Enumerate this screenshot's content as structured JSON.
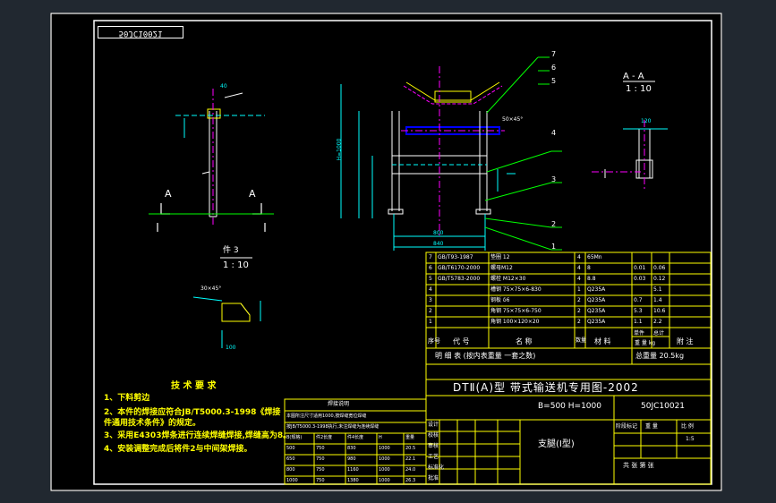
{
  "drawing": {
    "stamp": "50JC10021",
    "section_label": "A - A",
    "section_scale": "1 : 10",
    "detail_label": "件 3",
    "detail_scale": "1 : 10",
    "cut_a_left": "A",
    "cut_a_right": "A",
    "height_dim": "H=1000",
    "width_dim_1": "800",
    "width_dim_2": "840",
    "chamfer_1": "50×45°",
    "chamfer_2": "30×45°",
    "dim_120": "120",
    "dim_100": "100",
    "dim_40": "40",
    "callouts": [
      "7",
      "6",
      "5",
      "4",
      "3",
      "2",
      "1"
    ]
  },
  "tech_requirements": {
    "title": "技 术 要 求",
    "items": [
      "1、下料剪边",
      "2、本件的焊接应符合JB/T5000.3-1998《焊接件通用技术条件》的规定。",
      "3、采用E4303焊条进行连续焊缝焊接,焊缝高为8。",
      "4、安装调整完成后将件2与中间架焊接。"
    ]
  },
  "parts_table": {
    "rows": [
      {
        "no": "7",
        "code": "GB/T93-1987",
        "name": "垫圈 12",
        "qty": "4",
        "material": "65Mn",
        "unit": "",
        "total": ""
      },
      {
        "no": "6",
        "code": "GB/T6170-2000",
        "name": "螺母M12",
        "qty": "4",
        "material": "8",
        "unit": "0.01",
        "total": "0.06"
      },
      {
        "no": "5",
        "code": "GB/T5783-2000",
        "name": "螺栓 M12×30",
        "qty": "4",
        "material": "8.8",
        "unit": "0.03",
        "total": "0.12"
      },
      {
        "no": "4",
        "code": "",
        "name": "槽钢 75×75×6-830",
        "qty": "1",
        "material": "Q235A",
        "unit": "",
        "total": "5.1"
      },
      {
        "no": "3",
        "code": "",
        "name": "钢板 δ6",
        "qty": "2",
        "material": "Q235A",
        "unit": "0.7",
        "total": "1.4"
      },
      {
        "no": "2",
        "code": "",
        "name": "角钢 75×75×6-750",
        "qty": "2",
        "material": "Q235A",
        "unit": "5.3",
        "total": "10.6"
      },
      {
        "no": "1",
        "code": "",
        "name": "角钢 100×120×20",
        "qty": "2",
        "material": "Q235A",
        "unit": "1.1",
        "total": "2.2"
      }
    ],
    "header": {
      "no": "序号",
      "code": "代 号",
      "name": "名 称",
      "qty": "数量",
      "material": "材 料",
      "unit": "单件",
      "total": "总计",
      "weight": "重 量 kg",
      "remark": "附 注"
    },
    "detail_row": "明 细 表 (按内表重量 一套之数)",
    "total_weight": "总重量 20.5kg"
  },
  "title_block": {
    "title": "DTⅡ(A)型 带式输送机专用图-2002",
    "params": "B=500 H=1000",
    "drawing_no": "50JC10021",
    "part_name": "支腿(Ⅰ型)",
    "stage": "阶段标记",
    "weight_label": "重 量",
    "scale_label": "比 例",
    "scale": "1:5",
    "sheet": "共  张  第  张",
    "roles": [
      "设计",
      "校核",
      "审核",
      "工艺",
      "标准化",
      "批准"
    ]
  },
  "weld_table": {
    "title": "焊接说明",
    "line1": "本图所注尺寸适用1000,按焊缝宽位焊缝",
    "line2": "按JB/T5000.3-1998执行,未注焊缝为连续焊缝",
    "headers": [
      "B(规格)",
      "件2长度",
      "件4长度",
      "H",
      "重量"
    ],
    "rows": [
      [
        "500",
        "750",
        "830",
        "1000",
        "20.5"
      ],
      [
        "650",
        "750",
        "980",
        "1000",
        "22.1"
      ],
      [
        "800",
        "750",
        "1160",
        "1000",
        "24.0"
      ],
      [
        "1000",
        "750",
        "1380",
        "1000",
        "26.3"
      ]
    ]
  }
}
